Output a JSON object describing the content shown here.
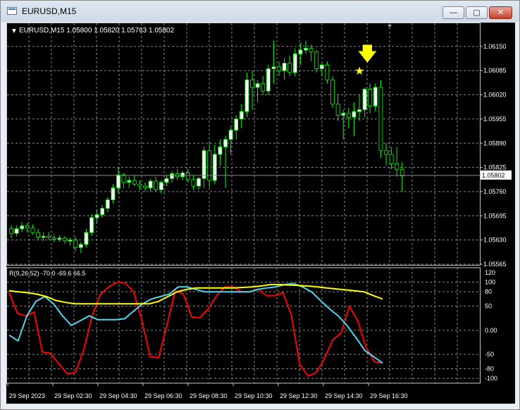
{
  "window": {
    "title": "EURUSD,M15",
    "min_symbol": "—",
    "max_symbol": "▢",
    "close_symbol": "✕"
  },
  "chart": {
    "header": "EURUSD,M15  1.05800 1.05820 1.05763 1.05802",
    "current_price_label": "1.05802",
    "current_price": 1.05802,
    "colors": {
      "background": "#000000",
      "grid": "#8c8c8c",
      "bull_candle": "#ffffff",
      "candle_outline": "#00ff00",
      "marker": "#ffff00",
      "line_red": "#ff0000",
      "line_cyan": "#4fd5ee",
      "line_yellow": "#ffff00",
      "text": "#ffffff"
    },
    "markers": [
      {
        "icon": "down-arrow-icon",
        "symbol": "🡇"
      },
      {
        "icon": "star-icon",
        "symbol": "★"
      }
    ]
  },
  "indicator": {
    "label": "R(9,26,52) -70.0 -69.6 66.5"
  },
  "chart_data": [
    {
      "type": "candlestick",
      "title": "EURUSD,M15",
      "ylim": [
        1.05565,
        1.0618
      ],
      "y_ticks": [
        "1.06150",
        "1.06085",
        "1.06020",
        "1.05955",
        "1.05890",
        "1.05825",
        "1.05760",
        "1.05695",
        "1.05630",
        "1.05565"
      ],
      "x_ticks": [
        "29 Sep 2023",
        "29 Sep 02:30",
        "29 Sep 04:30",
        "29 Sep 06:30",
        "29 Sep 08:30",
        "29 Sep 10:30",
        "29 Sep 12:30",
        "29 Sep 14:30",
        "29 Sep 16:30"
      ],
      "candles": [
        [
          1.0566,
          1.0567,
          1.05635,
          1.05648
        ],
        [
          1.05648,
          1.05668,
          1.0564,
          1.0566
        ],
        [
          1.0566,
          1.05678,
          1.05652,
          1.05668
        ],
        [
          1.05668,
          1.05676,
          1.0565,
          1.05662
        ],
        [
          1.05662,
          1.05672,
          1.05645,
          1.0565
        ],
        [
          1.0565,
          1.0566,
          1.0563,
          1.05638
        ],
        [
          1.05638,
          1.0565,
          1.05628,
          1.0564
        ],
        [
          1.0564,
          1.05652,
          1.0563,
          1.05636
        ],
        [
          1.05636,
          1.05645,
          1.05625,
          1.05632
        ],
        [
          1.05632,
          1.05642,
          1.05625,
          1.05635
        ],
        [
          1.05635,
          1.0564,
          1.0562,
          1.05628
        ],
        [
          1.05628,
          1.05636,
          1.05615,
          1.0563
        ],
        [
          1.0563,
          1.0564,
          1.056,
          1.0561
        ],
        [
          1.0561,
          1.05625,
          1.05595,
          1.05618
        ],
        [
          1.05618,
          1.0566,
          1.0561,
          1.0565
        ],
        [
          1.0565,
          1.057,
          1.0564,
          1.0569
        ],
        [
          1.0569,
          1.0571,
          1.05675,
          1.05698
        ],
        [
          1.05698,
          1.05725,
          1.0569,
          1.05715
        ],
        [
          1.05715,
          1.05745,
          1.05705,
          1.05738
        ],
        [
          1.05738,
          1.0578,
          1.05728,
          1.0577
        ],
        [
          1.0577,
          1.05825,
          1.05755,
          1.05805
        ],
        [
          1.05805,
          1.0581,
          1.0577,
          1.05785
        ],
        [
          1.05785,
          1.058,
          1.0577,
          1.0579
        ],
        [
          1.0579,
          1.05805,
          1.05775,
          1.0578
        ],
        [
          1.0578,
          1.0579,
          1.05765,
          1.05775
        ],
        [
          1.05775,
          1.05785,
          1.0576,
          1.0577
        ],
        [
          1.0577,
          1.05795,
          1.0576,
          1.05788
        ],
        [
          1.05788,
          1.058,
          1.0576,
          1.05765
        ],
        [
          1.05765,
          1.0579,
          1.05755,
          1.05785
        ],
        [
          1.05785,
          1.05805,
          1.05775,
          1.05795
        ],
        [
          1.05795,
          1.05815,
          1.05785,
          1.05808
        ],
        [
          1.05808,
          1.0582,
          1.0579,
          1.058
        ],
        [
          1.058,
          1.05815,
          1.0579,
          1.0581
        ],
        [
          1.0581,
          1.0582,
          1.05785,
          1.05792
        ],
        [
          1.05792,
          1.05805,
          1.05765,
          1.05775
        ],
        [
          1.05775,
          1.058,
          1.05765,
          1.05795
        ],
        [
          1.05795,
          1.0588,
          1.0577,
          1.0587
        ],
        [
          1.0587,
          1.05895,
          1.0577,
          1.0579
        ],
        [
          1.0579,
          1.05885,
          1.0578,
          1.0586
        ],
        [
          1.0586,
          1.059,
          1.0583,
          1.0588
        ],
        [
          1.0588,
          1.0591,
          1.0577,
          1.059
        ],
        [
          1.059,
          1.05935,
          1.0586,
          1.05925
        ],
        [
          1.05925,
          1.05965,
          1.059,
          1.05955
        ],
        [
          1.05955,
          1.05995,
          1.0593,
          1.05975
        ],
        [
          1.05975,
          1.0608,
          1.0596,
          1.0606
        ],
        [
          1.0606,
          1.06085,
          1.0598,
          1.0604
        ],
        [
          1.0604,
          1.0606,
          1.06,
          1.0605
        ],
        [
          1.0605,
          1.0607,
          1.0602,
          1.0603
        ],
        [
          1.0603,
          1.061,
          1.0602,
          1.0609
        ],
        [
          1.0609,
          1.06165,
          1.0605,
          1.06095
        ],
        [
          1.06095,
          1.0611,
          1.0607,
          1.06085
        ],
        [
          1.06085,
          1.0612,
          1.0606,
          1.06105
        ],
        [
          1.06105,
          1.06125,
          1.0607,
          1.0608
        ],
        [
          1.0608,
          1.06145,
          1.0607,
          1.0613
        ],
        [
          1.0613,
          1.0616,
          1.061,
          1.0614
        ],
        [
          1.0614,
          1.06165,
          1.0613,
          1.06145
        ],
        [
          1.06145,
          1.06155,
          1.0611,
          1.06135
        ],
        [
          1.06135,
          1.0614,
          1.0608,
          1.0609
        ],
        [
          1.0609,
          1.06105,
          1.0607,
          1.061
        ],
        [
          1.061,
          1.0611,
          1.0605,
          1.0606
        ],
        [
          1.0606,
          1.0607,
          1.05985,
          1.05995
        ],
        [
          1.05995,
          1.0602,
          1.0595,
          1.05965
        ],
        [
          1.05965,
          1.0598,
          1.059,
          1.0597
        ],
        [
          1.0597,
          1.05985,
          1.0593,
          1.0596
        ],
        [
          1.0596,
          1.06,
          1.0591,
          1.05975
        ],
        [
          1.05975,
          1.0602,
          1.0595,
          1.0598
        ],
        [
          1.0598,
          1.0604,
          1.0596,
          1.06035
        ],
        [
          1.06035,
          1.0605,
          1.0597,
          1.0599
        ],
        [
          1.0599,
          1.0605,
          1.05975,
          1.0604
        ],
        [
          1.0604,
          1.0606,
          1.0585,
          1.0587
        ],
        [
          1.0587,
          1.0589,
          1.0583,
          1.0586
        ],
        [
          1.0586,
          1.0588,
          1.0582,
          1.05835
        ],
        [
          1.05835,
          1.0588,
          1.058,
          1.0582
        ],
        [
          1.0582,
          1.0584,
          1.0576,
          1.05802
        ]
      ]
    },
    {
      "type": "line",
      "title": "R(9,26,52) -70.0 -69.6 66.5",
      "ylim": [
        -110,
        130
      ],
      "y_ticks": [
        "120",
        "100",
        "80",
        "50",
        "0.00",
        "-50",
        "-80",
        "-100"
      ],
      "series": [
        {
          "color": "#ff0000",
          "values": [
            78,
            35,
            30,
            38,
            -45,
            -48,
            -70,
            -90,
            -88,
            -40,
            30,
            75,
            90,
            100,
            98,
            80,
            20,
            -55,
            -57,
            10,
            82,
            75,
            28,
            26,
            45,
            72,
            90,
            90,
            80,
            80,
            86,
            72,
            72,
            78,
            32,
            -70,
            -95,
            -88,
            -58,
            -20,
            -5,
            50,
            20,
            -35,
            -65,
            -68
          ]
        },
        {
          "color": "#4fd5ee",
          "values": [
            -10,
            -22,
            30,
            60,
            70,
            55,
            30,
            10,
            20,
            30,
            22,
            22,
            22,
            24,
            40,
            55,
            65,
            70,
            75,
            90,
            90,
            85,
            80,
            80,
            80,
            80,
            80,
            80,
            85,
            88,
            90,
            95,
            97,
            90,
            80,
            62,
            45,
            30,
            10,
            -15,
            -42,
            -55,
            -68
          ]
        },
        {
          "color": "#ffff00",
          "values": [
            82,
            80,
            78,
            75,
            70,
            62,
            58,
            55,
            55,
            55,
            55,
            55,
            55,
            55,
            55,
            55,
            60,
            70,
            80,
            85,
            88,
            88,
            88,
            88,
            88,
            89,
            90,
            92,
            95,
            95,
            94,
            93,
            92,
            90,
            88,
            86,
            84,
            82,
            80,
            72,
            65
          ]
        }
      ]
    }
  ]
}
